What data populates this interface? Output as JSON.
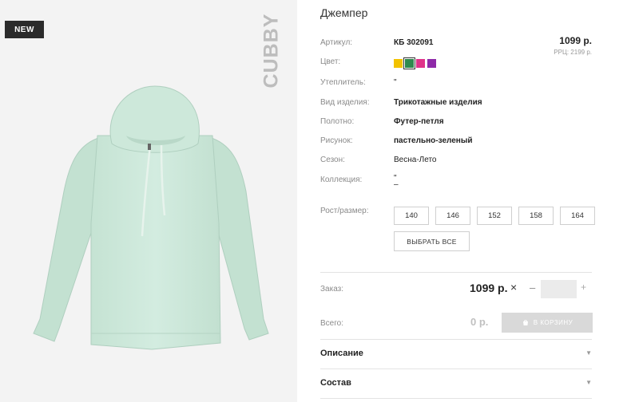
{
  "badge": "NEW",
  "brand": "CUBBY",
  "product": {
    "title": "Джемпер",
    "price": "1099 р.",
    "rrc": "РРЦ: 2199 р.",
    "specs": [
      {
        "label": "Артикул:",
        "value": "КБ 302091"
      },
      {
        "label": "Цвет:",
        "value": ""
      },
      {
        "label": "Утеплитель:",
        "value": "\""
      },
      {
        "label": "Вид изделия:",
        "value": "Трикотажные изделия"
      },
      {
        "label": "Полотно:",
        "value": "Футер-петля"
      },
      {
        "label": "Рисунок:",
        "value": "пастельно-зеленый"
      },
      {
        "label": "Сезон:",
        "value": "Весна-Лето"
      },
      {
        "label": "Коллекция:",
        "value": "\"\n–"
      }
    ],
    "colors": [
      "#f2c200",
      "#2f8a4e",
      "#e0338a",
      "#8e2aa8"
    ],
    "active_color_index": 1
  },
  "size": {
    "label": "Рост/размер:",
    "options": [
      "140",
      "146",
      "152",
      "158",
      "164"
    ],
    "select_all": "ВЫБРАТЬ ВСЕ"
  },
  "order": {
    "label": "Заказ:",
    "price": "1099 р.",
    "times": "×",
    "minus": "–",
    "plus": "+",
    "quantity": ""
  },
  "total": {
    "label": "Всего:",
    "value": "0 р.",
    "cart_button": "В КОРЗИНУ"
  },
  "accordion": [
    {
      "title": "Описание"
    },
    {
      "title": "Состав"
    }
  ]
}
